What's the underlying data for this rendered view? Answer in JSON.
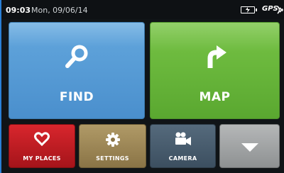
{
  "statusbar": {
    "time": "09:03",
    "date": "Mon, 09/06/14",
    "gps_label": "GPS",
    "battery_icon": "battery-charging-icon",
    "signal_icon": "gps-signal-icon"
  },
  "tiles": {
    "find": {
      "label": "FIND",
      "icon": "search-icon",
      "color": "#5da1d9"
    },
    "map": {
      "label": "MAP",
      "icon": "turn-arrow-icon",
      "color": "#6ebb3f"
    },
    "my_places": {
      "label": "MY PLACES",
      "icon": "heart-icon",
      "color": "#c01c22"
    },
    "settings": {
      "label": "SETTINGS",
      "icon": "gear-icon",
      "color": "#9c8555"
    },
    "camera": {
      "label": "CAMERA",
      "icon": "video-camera-icon",
      "color": "#4a5e70"
    },
    "more": {
      "label": "",
      "icon": "chevron-down-icon",
      "color": "#a3a5a6"
    }
  }
}
